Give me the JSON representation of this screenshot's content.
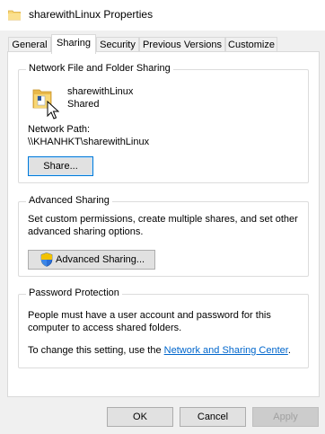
{
  "window": {
    "title": "sharewithLinux Properties"
  },
  "tabs": [
    {
      "label": "General"
    },
    {
      "label": "Sharing"
    },
    {
      "label": "Security"
    },
    {
      "label": "Previous Versions"
    },
    {
      "label": "Customize"
    }
  ],
  "network_sharing": {
    "title": "Network File and Folder Sharing",
    "folder_name": "sharewithLinux",
    "status": "Shared",
    "path_label": "Network Path:",
    "path_value": "\\\\KHANHKT\\sharewithLinux",
    "share_button": "Share..."
  },
  "advanced_sharing": {
    "title": "Advanced Sharing",
    "description_line1": "Set custom permissions, create multiple shares, and set other",
    "description_line2": "advanced sharing options.",
    "button_label": "Advanced Sharing..."
  },
  "password_protection": {
    "title": "Password Protection",
    "description_line1": "People must have a user account and password for this",
    "description_line2": "computer to access shared folders.",
    "change_text": "To change this setting, use the ",
    "link_text": "Network and Sharing Center",
    "change_suffix": "."
  },
  "dialog_buttons": {
    "ok": "OK",
    "cancel": "Cancel",
    "apply": "Apply"
  },
  "colors": {
    "link": "#0066cc",
    "focus_border": "#0078d7",
    "folder_yellow": "#f8d775"
  },
  "icons": {
    "title": "folder-icon",
    "folder": "shared-folder-icon",
    "cursor": "mouse-pointer-icon",
    "shield": "uac-shield-icon"
  }
}
